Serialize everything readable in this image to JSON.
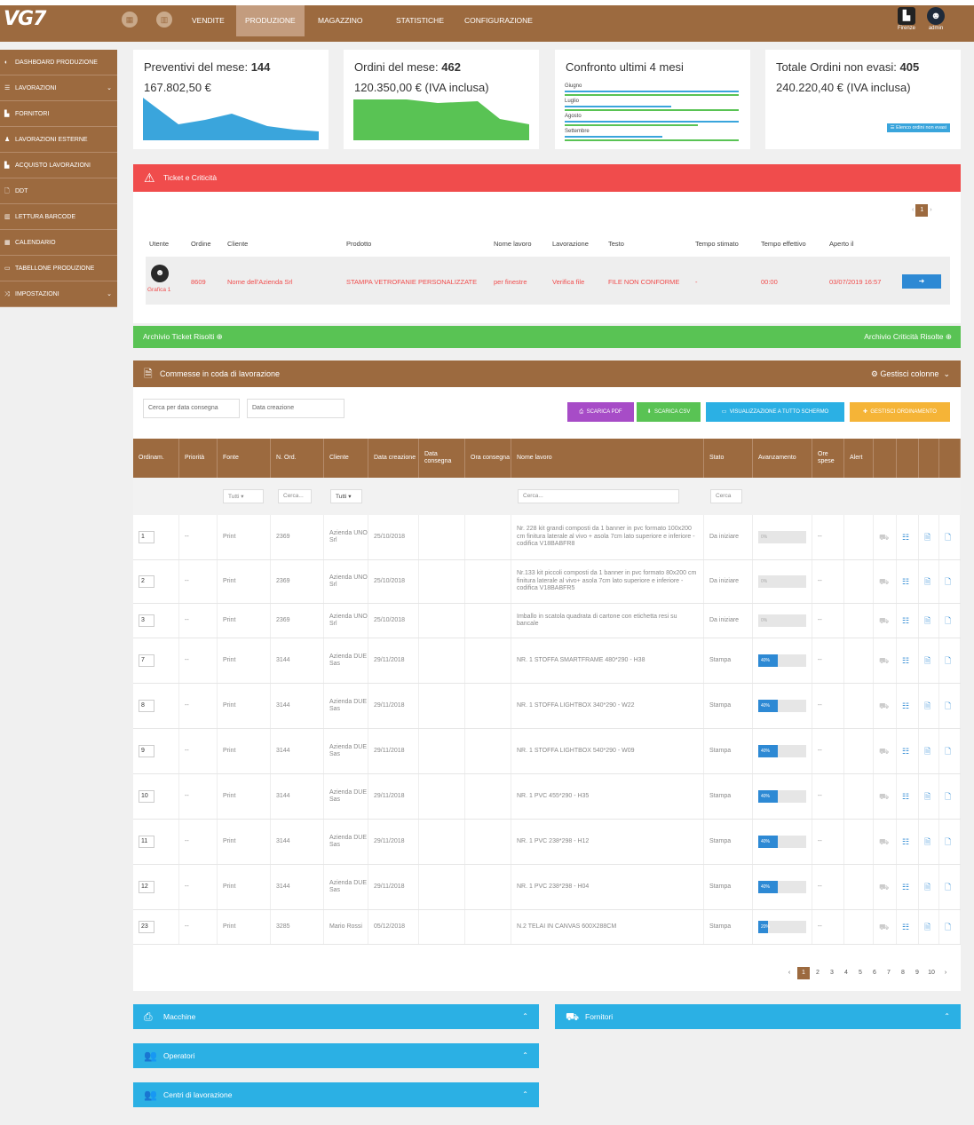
{
  "topbar": {
    "logo": "VG7",
    "nav": [
      "VENDITE",
      "PRODUZIONE",
      "MAGAZZINO",
      "STATISTICHE",
      "CONFIGURAZIONE"
    ],
    "active_nav": "PRODUZIONE",
    "user1": "Firenze",
    "user2": "admin"
  },
  "sidebar": [
    {
      "label": "DASHBOARD PRODUZIONE",
      "icon": "dashboard-icon"
    },
    {
      "label": "LAVORAZIONI",
      "icon": "list-icon",
      "chevron": true
    },
    {
      "label": "FORNITORI",
      "icon": "factory-icon"
    },
    {
      "label": "LAVORAZIONI ESTERNE",
      "icon": "user-secret-icon"
    },
    {
      "label": "ACQUISTO LAVORAZIONI",
      "icon": "factory-icon"
    },
    {
      "label": "DDT",
      "icon": "file-icon"
    },
    {
      "label": "LETTURA BARCODE",
      "icon": "barcode-icon"
    },
    {
      "label": "CALENDARIO",
      "icon": "calendar-icon"
    },
    {
      "label": "TABELLONE PRODUZIONE",
      "icon": "monitor-icon"
    },
    {
      "label": "IMPOSTAZIONI",
      "icon": "shuffle-icon",
      "chevron": true
    }
  ],
  "kpi": {
    "preventivi": {
      "title": "Preventivi del mese:",
      "count": "144",
      "value": "167.802,50 €"
    },
    "ordini": {
      "title": "Ordini del mese:",
      "count": "462",
      "value": "120.350,00 € (IVA inclusa)"
    },
    "confronto": {
      "title": "Confronto ultimi 4 mesi",
      "months": [
        "Giugno",
        "Luglio",
        "Agosto",
        "Settembre"
      ]
    },
    "non_evasi": {
      "title": "Totale Ordini non evasi:",
      "count": "405",
      "value": "240.220,40 € (IVA inclusa)",
      "button": "☰ Elenco ordini non evasi"
    }
  },
  "ticket": {
    "title": "Ticket e Criticità",
    "page": "1",
    "headers": [
      "Utente",
      "Ordine",
      "Cliente",
      "Prodotto",
      "Nome lavoro",
      "Lavorazione",
      "Testo",
      "Tempo stimato",
      "Tempo effettivo",
      "Aperto il"
    ],
    "row": {
      "utente": "Grafica 1",
      "ordine": "8609",
      "cliente": "Nome dell'Azienda Srl",
      "prodotto": "STAMPA VETROFANIE PERSONALIZZATE",
      "nome_lavoro": "per finestre",
      "lavorazione": "Verifica file",
      "testo": "FILE NON CONFORME",
      "tempo_stimato": "-",
      "tempo_effettivo": "00:00",
      "aperto_il": "03/07/2019 16:57"
    }
  },
  "archive": {
    "left": "Archivio Ticket Risolti ⊕",
    "right": "Archivio Criticità Risolte ⊕"
  },
  "commesse": {
    "title": "Commesse in coda di lavorazione",
    "gestisci": "Gestisci colonne",
    "search_date": "Cerca per data consegna",
    "creation_date": "Data creazione",
    "buttons": [
      {
        "label": "SCARICA PDF",
        "color": "#a74cc7"
      },
      {
        "label": "SCARICA CSV",
        "color": "#59c354"
      },
      {
        "label": "VISUALIZZAZIONE A TUTTO SCHERMO",
        "color": "#2bb0e4"
      },
      {
        "label": "GESTISCI ORDINAMENTO",
        "color": "#f5b437"
      }
    ],
    "columns": [
      "Ordinam.",
      "Priorità",
      "Fonte",
      "N. Ord.",
      "Cliente",
      "Data creazione",
      "Data consegna",
      "Ora consegna",
      "Nome lavoro",
      "Stato",
      "Avanzamento",
      "Ore spese",
      "Alert"
    ],
    "filters": {
      "tutti": "Tutti",
      "cerca": "Cerca...",
      "cerca2": "Cerca"
    },
    "rows": [
      {
        "ord": "1",
        "prio": "--",
        "fonte": "Print",
        "nord": "2369",
        "cliente": "Azienda UNO Srl",
        "data": "25/10/2018",
        "nome": "Nr. 228 kit grandi composti da 1 banner in pvc formato 100x200 cm finitura laterale al vivo + asola 7cm lato superiore e inferiore - codifica V18BABFR8",
        "stato": "Da iniziare",
        "av": 0,
        "ore": "--"
      },
      {
        "ord": "2",
        "prio": "--",
        "fonte": "Print",
        "nord": "2369",
        "cliente": "Azienda UNO Srl",
        "data": "25/10/2018",
        "nome": "Nr.133 kit piccoli composti da 1 banner in pvc formato 80x200 cm finitura laterale al vivo+ asola 7cm lato superiore e inferiore - codifica V18BABFR5",
        "stato": "Da iniziare",
        "av": 0,
        "ore": "--"
      },
      {
        "ord": "3",
        "prio": "--",
        "fonte": "Print",
        "nord": "2369",
        "cliente": "Azienda UNO Srl",
        "data": "25/10/2018",
        "nome": "Imballo in scatola quadrata di cartone con etichetta resi su bancale",
        "stato": "Da iniziare",
        "av": 0,
        "ore": "--"
      },
      {
        "ord": "7",
        "prio": "--",
        "fonte": "Print",
        "nord": "3144",
        "cliente": "Azienda DUE Sas",
        "data": "29/11/2018",
        "nome": "NR. 1 STOFFA SMARTFRAME 480*290 - H38",
        "stato": "Stampa",
        "av": 40,
        "ore": "--"
      },
      {
        "ord": "8",
        "prio": "--",
        "fonte": "Print",
        "nord": "3144",
        "cliente": "Azienda DUE Sas",
        "data": "29/11/2018",
        "nome": "NR. 1 STOFFA LIGHTBOX 340*290 - W22",
        "stato": "Stampa",
        "av": 40,
        "ore": "--"
      },
      {
        "ord": "9",
        "prio": "--",
        "fonte": "Print",
        "nord": "3144",
        "cliente": "Azienda DUE Sas",
        "data": "29/11/2018",
        "nome": "NR. 1 STOFFA LIGHTBOX 540*290 - W09",
        "stato": "Stampa",
        "av": 40,
        "ore": "--"
      },
      {
        "ord": "10",
        "prio": "--",
        "fonte": "Print",
        "nord": "3144",
        "cliente": "Azienda DUE Sas",
        "data": "29/11/2018",
        "nome": "NR. 1 PVC 455*290 - H35",
        "stato": "Stampa",
        "av": 40,
        "ore": "--"
      },
      {
        "ord": "11",
        "prio": "--",
        "fonte": "Print",
        "nord": "3144",
        "cliente": "Azienda DUE Sas",
        "data": "29/11/2018",
        "nome": "NR. 1 PVC 238*298 - H12",
        "stato": "Stampa",
        "av": 40,
        "ore": "--"
      },
      {
        "ord": "12",
        "prio": "--",
        "fonte": "Print",
        "nord": "3144",
        "cliente": "Azienda DUE Sas",
        "data": "29/11/2018",
        "nome": "NR. 1 PVC 238*298 - H04",
        "stato": "Stampa",
        "av": 40,
        "ore": "--"
      },
      {
        "ord": "23",
        "prio": "--",
        "fonte": "Print",
        "nord": "3285",
        "cliente": "Mario Rossi",
        "data": "05/12/2018",
        "nome": "N.2 TELAI IN CANVAS 600X288CM",
        "stato": "Stampa",
        "av": 20,
        "ore": "--"
      }
    ],
    "pages": [
      "1",
      "2",
      "3",
      "4",
      "5",
      "6",
      "7",
      "8",
      "9",
      "10"
    ]
  },
  "panels": {
    "macchine": "Macchine",
    "fornitori": "Fornitori",
    "operatori": "Operatori",
    "centri": "Centri di lavorazione"
  }
}
